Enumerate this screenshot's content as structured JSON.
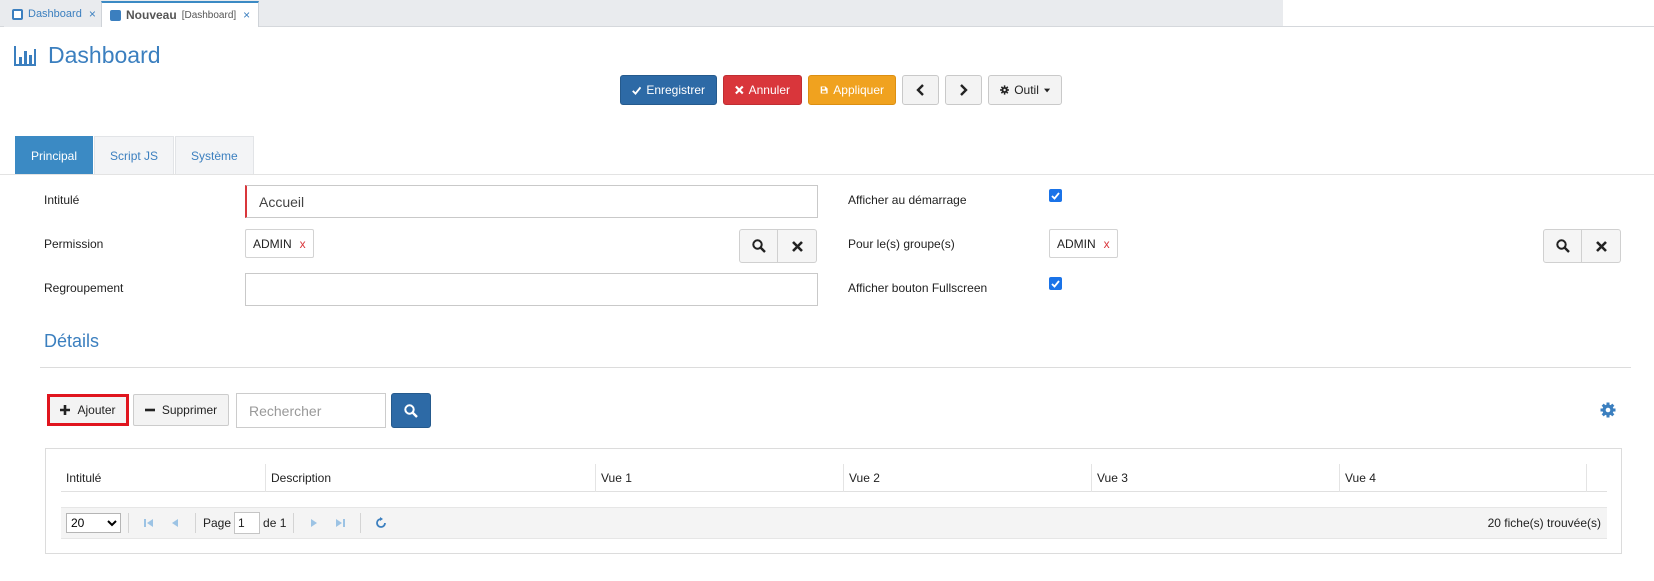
{
  "tabs": [
    {
      "label": "Dashboard",
      "sub": "",
      "active": false
    },
    {
      "label": "Nouveau",
      "sub": "[Dashboard]",
      "active": true
    }
  ],
  "page": {
    "title": "Dashboard"
  },
  "toolbar": {
    "save_label": "Enregistrer",
    "cancel_label": "Annuler",
    "apply_label": "Appliquer",
    "tool_label": "Outil"
  },
  "form_tabs": [
    "Principal",
    "Script JS",
    "Système"
  ],
  "form": {
    "intitule_label": "Intitulé",
    "intitule_value": "Accueil",
    "permission_label": "Permission",
    "permission_tag": "ADMIN",
    "regroupement_label": "Regroupement",
    "regroupement_value": "",
    "afficher_demarrage_label": "Afficher au démarrage",
    "afficher_demarrage_checked": true,
    "groupes_label": "Pour le(s) groupe(s)",
    "groupes_tag": "ADMIN",
    "fullscreen_label": "Afficher bouton Fullscreen",
    "fullscreen_checked": true,
    "tag_remove": "x"
  },
  "details": {
    "title": "Détails",
    "add_label": "Ajouter",
    "delete_label": "Supprimer",
    "search_placeholder": "Rechercher"
  },
  "grid": {
    "columns": [
      "Intitulé",
      "Description",
      "Vue 1",
      "Vue 2",
      "Vue 3",
      "Vue 4"
    ],
    "rows": [],
    "page_size": "20",
    "page_label": "Page",
    "page_value": "1",
    "page_of": "de 1",
    "count_text": "20 fiche(s) trouvée(s)"
  },
  "colors": {
    "accent": "#3b7fbf",
    "primary": "#2d6aa6",
    "danger": "#d9363b",
    "warning": "#f0a21f",
    "highlight": "#e0151e"
  }
}
